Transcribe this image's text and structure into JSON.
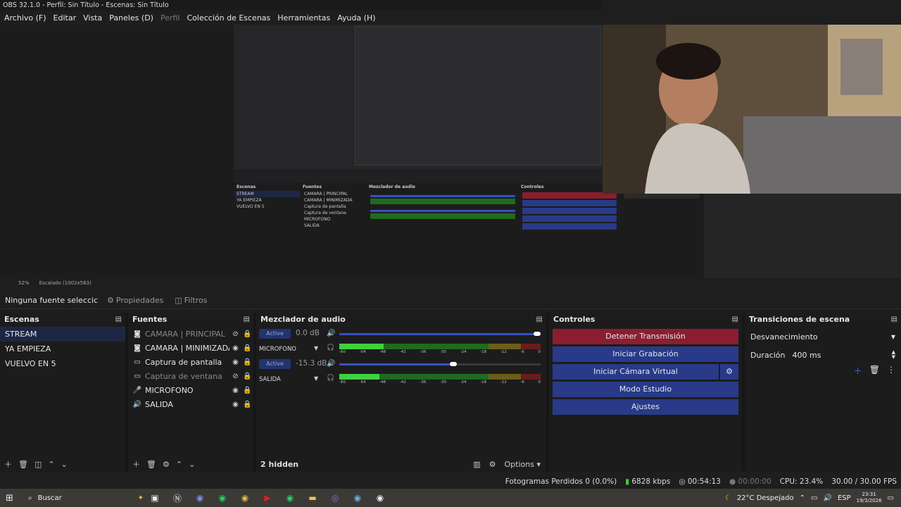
{
  "window": {
    "title": "OBS 32.1.0 - Perfil: Sin Título - Escenas: Sin Título"
  },
  "menu": [
    "Archivo (F)",
    "Editar",
    "Vista",
    "Paneles (D)",
    "Perfil",
    "Colección de Escenas",
    "Herramientas",
    "Ayuda (H)"
  ],
  "preview": {
    "zoom": "52%",
    "scale": "Escalado (1002x563)"
  },
  "props": {
    "no_source": "Ninguna fuente seleccic",
    "properties": "Propiedades",
    "filters": "Filtros"
  },
  "scenes": {
    "title": "Escenas",
    "items": [
      "STREAM",
      "YA EMPIEZA",
      "VUELVO EN 5"
    ],
    "selected": "STREAM"
  },
  "sources": {
    "title": "Fuentes",
    "items": [
      {
        "name": "CAMARA | PRINCIPAL",
        "icon": "camera-icon",
        "visible": false
      },
      {
        "name": "CAMARA | MINIMIZADA",
        "icon": "camera-icon",
        "visible": true
      },
      {
        "name": "Captura de pantalla",
        "icon": "monitor-icon",
        "visible": true
      },
      {
        "name": "Captura de ventana",
        "icon": "window-icon",
        "visible": false
      },
      {
        "name": "MICROFONO",
        "icon": "microphone-icon",
        "visible": true
      },
      {
        "name": "SALIDA",
        "icon": "speaker-icon",
        "visible": true
      }
    ]
  },
  "mixer": {
    "title": "Mezclador de audio",
    "channels": [
      {
        "name": "MICROFONO",
        "active": "Active",
        "db": "0.0 dB",
        "volume": 1.0,
        "level": 0.22
      },
      {
        "name": "SALIDA",
        "active": "Active",
        "db": "-15.3 dB",
        "volume": 0.55,
        "level": 0.2
      }
    ],
    "scale": [
      "-60",
      "-54",
      "-48",
      "-42",
      "-36",
      "-30",
      "-24",
      "-18",
      "-12",
      "-6",
      "0"
    ],
    "hidden": "2 hidden",
    "options": "Options"
  },
  "controls": {
    "title": "Controles",
    "buttons": [
      "Detener Transmisión",
      "Iniciar Grabación",
      "Iniciar Cámara Virtual",
      "Modo Estudio",
      "Ajustes"
    ]
  },
  "transitions": {
    "title": "Transiciones de escena",
    "selected": "Desvanecimiento",
    "duration_label": "Duración",
    "duration": "400 ms"
  },
  "status": {
    "dropped": "Fotogramas Perdidos 0 (0.0%)",
    "bitrate": "6828 kbps",
    "stream_time": "00:54:13",
    "rec_time": "00:00:00",
    "cpu": "CPU: 23.4%",
    "fps": "30.00 / 30.00 FPS"
  },
  "taskbar": {
    "search": "Buscar",
    "weather": "22°C  Despejado",
    "lang": "ESP",
    "time": "23:31",
    "date": "19/3/2026"
  },
  "colors": {
    "accent": "#283a88",
    "stop": "#8a1e30",
    "selected": "#1d2744"
  }
}
